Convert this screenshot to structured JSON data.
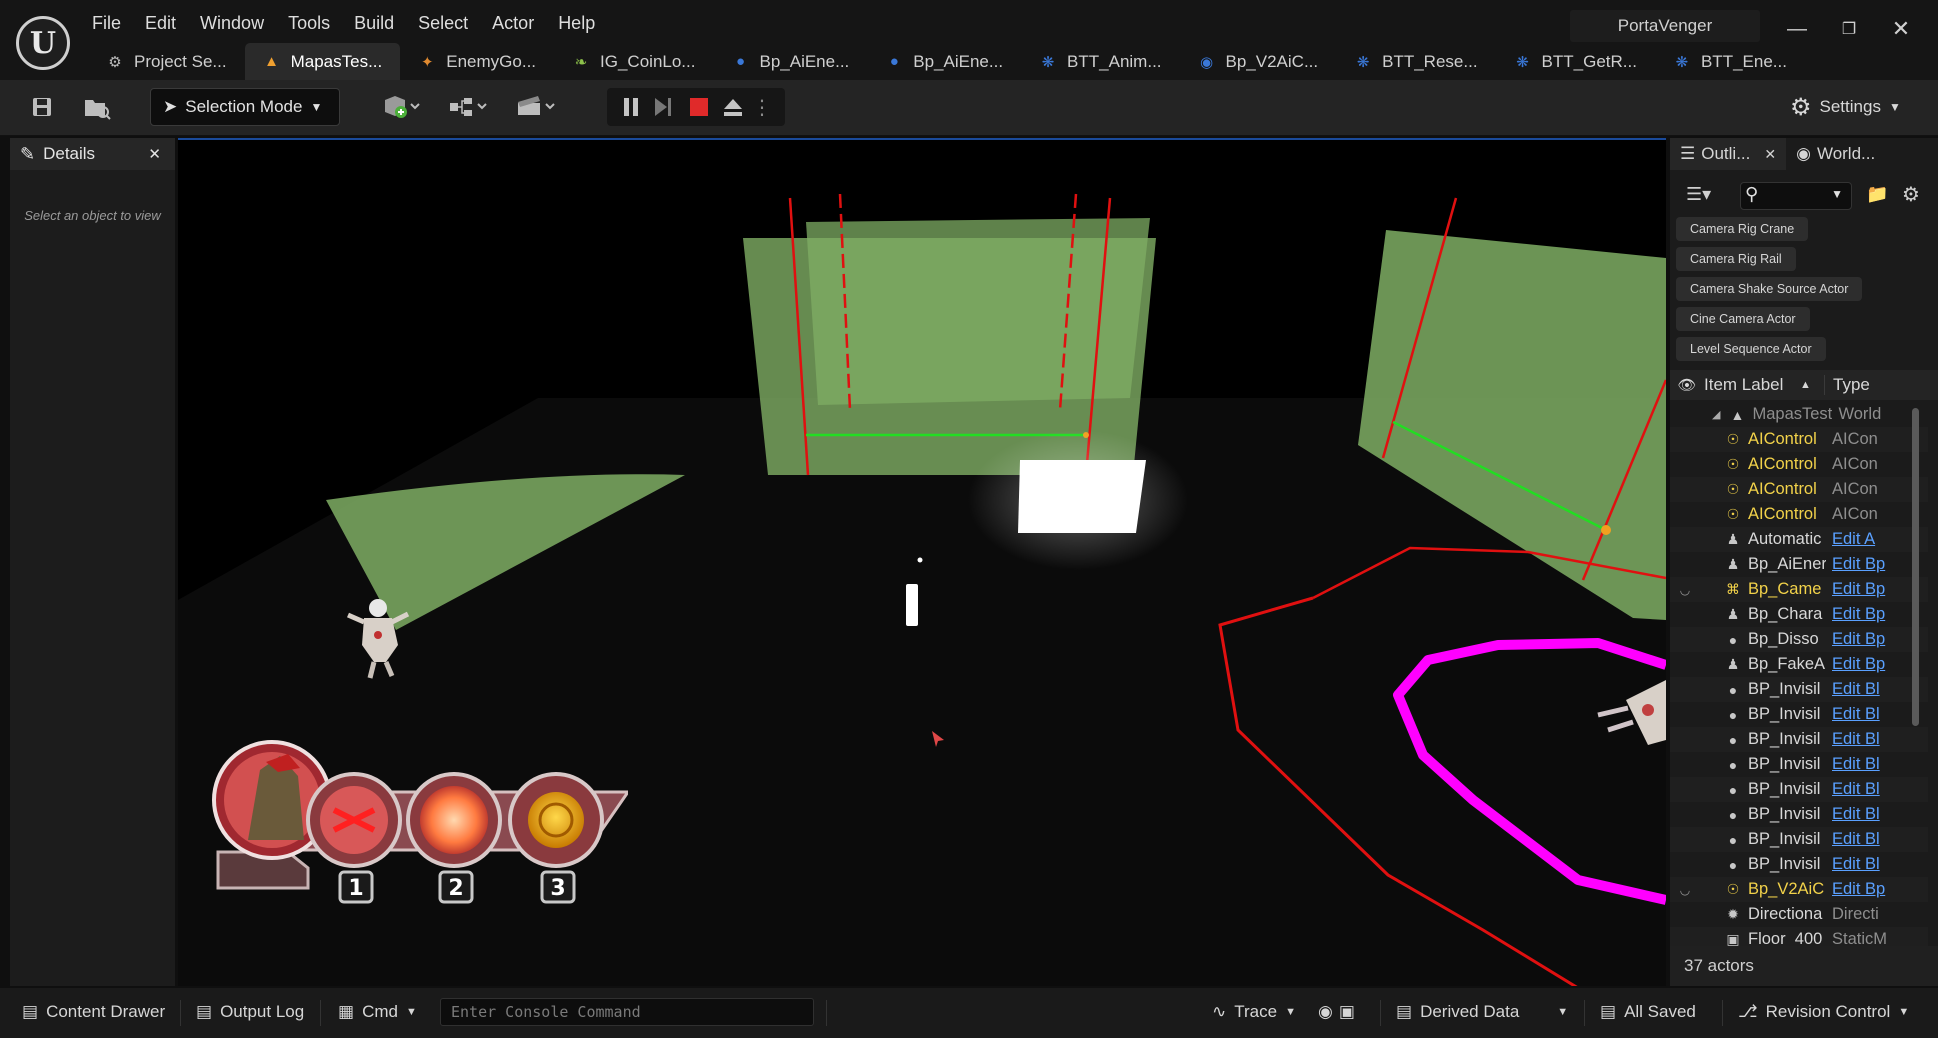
{
  "menu": [
    "File",
    "Edit",
    "Window",
    "Tools",
    "Build",
    "Select",
    "Actor",
    "Help"
  ],
  "project_name": "PortaVenger",
  "tabs": [
    {
      "label": "Project Se...",
      "icon": "gear-icon"
    },
    {
      "label": "MapasTes...",
      "icon": "level-icon",
      "active": true
    },
    {
      "label": "EnemyGo...",
      "icon": "animation-icon"
    },
    {
      "label": "IG_CoinLo...",
      "icon": "input-icon"
    },
    {
      "label": "Bp_AiEne...",
      "icon": "character-icon"
    },
    {
      "label": "Bp_AiEne...",
      "icon": "character-icon"
    },
    {
      "label": "BTT_Anim...",
      "icon": "behavior-task-icon"
    },
    {
      "label": "Bp_V2AiC...",
      "icon": "ai-controller-icon"
    },
    {
      "label": "BTT_Rese...",
      "icon": "behavior-task-icon"
    },
    {
      "label": "BTT_GetR...",
      "icon": "behavior-task-icon"
    },
    {
      "label": "BTT_Ene...",
      "icon": "behavior-task-icon"
    }
  ],
  "toolbar": {
    "selection_mode": "Selection Mode",
    "settings": "Settings"
  },
  "details": {
    "title": "Details",
    "empty_text": "Select an object to view"
  },
  "outliner": {
    "tab_outliner": "Outli...",
    "tab_world": "World...",
    "chips": [
      "Camera Rig Crane",
      "Camera Rig Rail",
      "Camera Shake Source Actor",
      "Cine Camera Actor",
      "Level Sequence Actor"
    ],
    "col_label": "Item Label",
    "col_type": "Type",
    "rows": [
      {
        "label": "MapasTeste",
        "type": "World",
        "icon": "level-icon",
        "root": true
      },
      {
        "label": "AIControl",
        "type": "AICon",
        "icon": "ai-controller-icon",
        "yellow": true
      },
      {
        "label": "AIControl",
        "type": "AICon",
        "icon": "ai-controller-icon",
        "yellow": true
      },
      {
        "label": "AIControl",
        "type": "AICon",
        "icon": "ai-controller-icon",
        "yellow": true
      },
      {
        "label": "AIControl",
        "type": "AICon",
        "icon": "ai-controller-icon",
        "yellow": true
      },
      {
        "label": "Automatic",
        "type": "Edit A",
        "icon": "pawn-icon",
        "link": true
      },
      {
        "label": "Bp_AiEner",
        "type": "Edit Bp",
        "icon": "pawn-icon",
        "link": true
      },
      {
        "label": "Bp_Came",
        "type": "Edit Bp",
        "icon": "gamepad-icon",
        "link": true,
        "yellow": true,
        "eye": true
      },
      {
        "label": "Bp_Chara",
        "type": "Edit Bp",
        "icon": "pawn-icon",
        "link": true
      },
      {
        "label": "Bp_Disso",
        "type": "Edit Bp",
        "icon": "actor-icon",
        "link": true
      },
      {
        "label": "Bp_FakeA",
        "type": "Edit Bp",
        "icon": "pawn-icon",
        "link": true
      },
      {
        "label": "BP_Invisil",
        "type": "Edit Bl",
        "icon": "actor-icon",
        "link": true
      },
      {
        "label": "BP_Invisil",
        "type": "Edit Bl",
        "icon": "actor-icon",
        "link": true
      },
      {
        "label": "BP_Invisil",
        "type": "Edit Bl",
        "icon": "actor-icon",
        "link": true
      },
      {
        "label": "BP_Invisil",
        "type": "Edit Bl",
        "icon": "actor-icon",
        "link": true
      },
      {
        "label": "BP_Invisil",
        "type": "Edit Bl",
        "icon": "actor-icon",
        "link": true
      },
      {
        "label": "BP_Invisil",
        "type": "Edit Bl",
        "icon": "actor-icon",
        "link": true
      },
      {
        "label": "BP_Invisil",
        "type": "Edit Bl",
        "icon": "actor-icon",
        "link": true
      },
      {
        "label": "BP_Invisil",
        "type": "Edit Bl",
        "icon": "actor-icon",
        "link": true
      },
      {
        "label": "Bp_V2AiC",
        "type": "Edit Bp",
        "icon": "ai-controller-icon",
        "link": true,
        "yellow": true,
        "eye": true
      },
      {
        "label": "Directiona",
        "type": "Directi",
        "icon": "light-icon"
      },
      {
        "label": "Floor_400",
        "type": "StaticM",
        "icon": "mesh-icon"
      }
    ],
    "actor_count": "37 actors"
  },
  "hud": {
    "slot_numbers": [
      "1",
      "2",
      "3"
    ]
  },
  "bottombar": {
    "content_drawer": "Content Drawer",
    "output_log": "Output Log",
    "cmd": "Cmd",
    "console_placeholder": "Enter Console Command",
    "trace": "Trace",
    "derived_data": "Derived Data",
    "all_saved": "All Saved",
    "revision_control": "Revision Control"
  },
  "colors": {
    "accent_blue": "#1a4a9a",
    "trigger_green": "#7fae64",
    "spline_red": "#e01010",
    "path_magenta": "#ff00ff",
    "outliner_yellow": "#f2d24a",
    "link_blue": "#5aa0ff"
  }
}
